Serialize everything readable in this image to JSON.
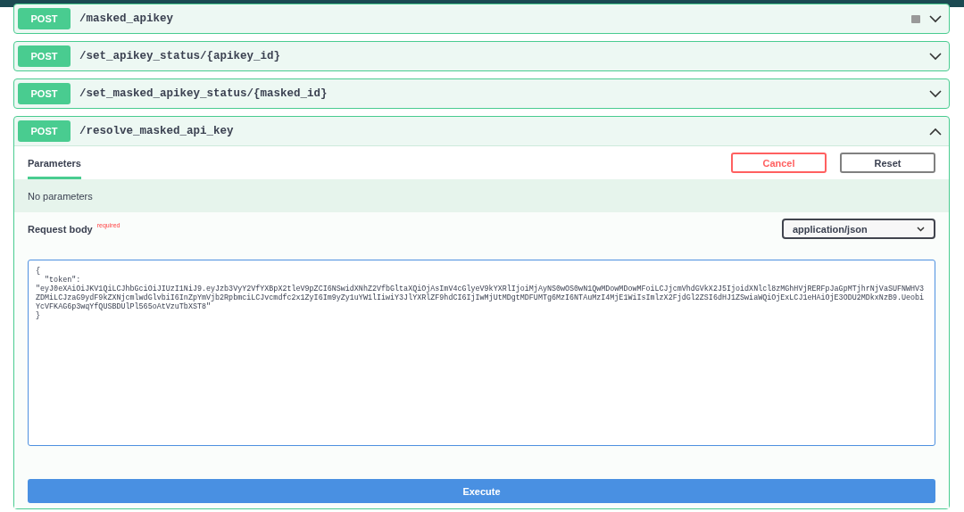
{
  "operations": [
    {
      "method": "POST",
      "path": "/masked_apikey",
      "expanded": false,
      "locked": true
    },
    {
      "method": "POST",
      "path": "/set_apikey_status/{apikey_id}",
      "expanded": false,
      "locked": false
    },
    {
      "method": "POST",
      "path": "/set_masked_apikey_status/{masked_id}",
      "expanded": false,
      "locked": false
    },
    {
      "method": "POST",
      "path": "/resolve_masked_api_key",
      "expanded": true,
      "locked": false,
      "detail": {
        "tabs": [
          {
            "label": "Parameters",
            "selected": true
          }
        ],
        "cancel": "Cancel",
        "reset": "Reset",
        "no_parameters": "No parameters",
        "request_body_label": "Request body",
        "required": "required",
        "content_type": "application/json",
        "body": "{\n  \"token\":\n\"eyJ0eXAiOiJKV1QiLCJhbGciOiJIUzI1NiJ9.eyJzb3VyY2VfYXBpX2tleV9pZCI6NSwidXNhZ2VfbGltaXQiOjAsImV4cGlyeV9kYXRlIjoiMjAyNS0wOS0wN1QwMDowMDowMFoiLCJjcmVhdGVkX2J5IjoidXNlcl8zMGhHVjRERFpJaGpMTjhrNjVaSUFNWHV3ZDMiLCJzaG9ydF9kZXNjcmlwdGlvbiI6InZpYmVjb2RpbmciLCJvcmdfc2x1ZyI6Im9yZy1uYW1lIiwiY3JlYXRlZF9hdCI6IjIwMjUtMDgtMDFUMTg6MzI6NTAuMzI4MjE1WiIsImlzX2FjdGl2ZSI6dHJ1ZSwiaWQiOjExLCJ1eHAiOjE3ODU2MDkxNzB9.UeobiYcVFKAG6p3wqYfQUSBDUlPl565oAtVzuTbXST8\"\n}",
        "execute": "Execute"
      }
    }
  ]
}
